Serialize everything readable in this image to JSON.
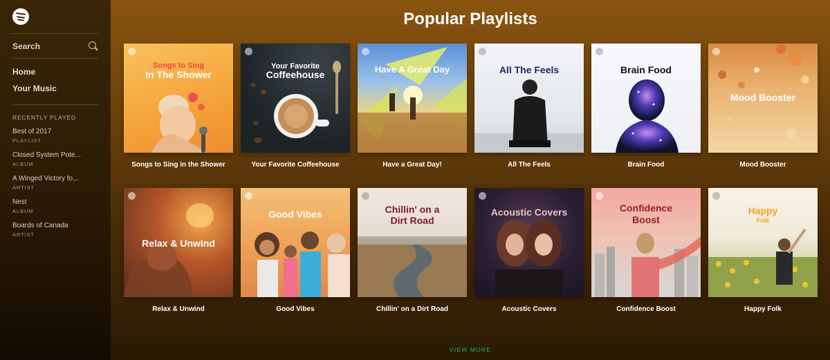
{
  "sidebar": {
    "search_label": "Search",
    "nav": [
      "Home",
      "Your Music"
    ],
    "recent_heading": "RECENTLY PLAYED",
    "recent": [
      {
        "title": "Best of 2017",
        "type": "PLAYLIST"
      },
      {
        "title": "Closed System Pote...",
        "type": "ALBUM"
      },
      {
        "title": "A Winged Victory fo...",
        "type": "ARTIST"
      },
      {
        "title": "Nest",
        "type": "ALBUM"
      },
      {
        "title": "Boards of Canada",
        "type": "ARTIST"
      }
    ]
  },
  "main": {
    "title": "Popular Playlists",
    "view_more": "VIEW MORE",
    "playlists": [
      {
        "label": "Songs to Sing in the Shower",
        "cover_lines": [
          "Songs to Sing",
          "In The Shower"
        ]
      },
      {
        "label": "Your Favorite Coffeehouse",
        "cover_lines": [
          "Your Favorite",
          "Coffeehouse"
        ]
      },
      {
        "label": "Have a Great Day!",
        "cover_lines": [
          "Have A Great Day"
        ]
      },
      {
        "label": "All The Feels",
        "cover_lines": [
          "All The Feels"
        ]
      },
      {
        "label": "Brain Food",
        "cover_lines": [
          "Brain Food"
        ]
      },
      {
        "label": "Mood Booster",
        "cover_lines": [
          "Mood Booster"
        ]
      },
      {
        "label": "Relax & Unwind",
        "cover_lines": [
          "Relax & Unwind"
        ]
      },
      {
        "label": "Good Vibes",
        "cover_lines": [
          "Good Vibes"
        ]
      },
      {
        "label": "Chillin' on a Dirt Road",
        "cover_lines": [
          "Chillin' on a",
          "Dirt Road"
        ]
      },
      {
        "label": "Acoustic Covers",
        "cover_lines": [
          "Acoustic Covers"
        ]
      },
      {
        "label": "Confidence Boost",
        "cover_lines": [
          "Confidence",
          "Boost"
        ]
      },
      {
        "label": "Happy Folk",
        "cover_lines": [
          "Happy",
          "Folk"
        ]
      }
    ]
  },
  "colors": {
    "accent_green": "#1db954",
    "sidebar_bg": "#3a2607",
    "main_bg_top": "#8a5410"
  },
  "icons": {
    "logo": "spotify-logo",
    "search": "search-icon"
  }
}
